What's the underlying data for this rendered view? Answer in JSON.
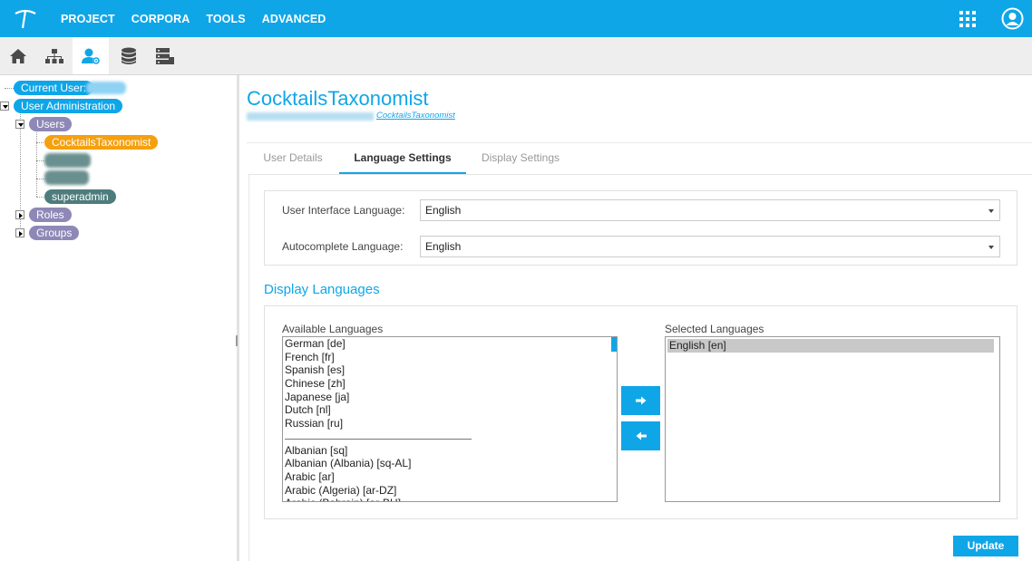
{
  "topbar": {
    "menu": [
      "PROJECT",
      "CORPORA",
      "TOOLS",
      "ADVANCED"
    ]
  },
  "toolbar": {
    "icons": [
      "home-icon",
      "hierarchy-icon",
      "user-admin-icon",
      "database-icon",
      "server-icon"
    ],
    "active_index": 2
  },
  "tree": {
    "current_user_label": "Current User:",
    "user_admin_label": "User Administration",
    "users_label": "Users",
    "user_items": [
      "CocktailsTaxonomist",
      "superadmin"
    ],
    "roles_label": "Roles",
    "groups_label": "Groups"
  },
  "header": {
    "title": "CocktailsTaxonomist",
    "sub_link": "CocktailsTaxonomist"
  },
  "tabs": [
    "User Details",
    "Language Settings",
    "Display Settings"
  ],
  "active_tab": "Language Settings",
  "language": {
    "ui_label": "User Interface Language:",
    "ui_value": "English",
    "autocomplete_label": "Autocomplete Language:",
    "autocomplete_value": "English"
  },
  "display_languages": {
    "heading": "Display Languages",
    "available_label": "Available Languages",
    "selected_label": "Selected Languages",
    "available_top": [
      "German [de]",
      "French [fr]",
      "Spanish [es]",
      "Chinese [zh]",
      "Japanese [ja]",
      "Dutch [nl]",
      "Russian [ru]"
    ],
    "available_rest": [
      "Albanian [sq]",
      "Albanian (Albania) [sq-AL]",
      "Arabic [ar]",
      "Arabic (Algeria) [ar-DZ]",
      "Arabic (Bahrain) [ar-BH]"
    ],
    "selected": [
      "English [en]"
    ]
  },
  "buttons": {
    "update": "Update"
  },
  "colors": {
    "accent": "#0fa6e8",
    "orange": "#f5a010",
    "purple": "#8e88b6",
    "teal": "#4e7c7c"
  }
}
